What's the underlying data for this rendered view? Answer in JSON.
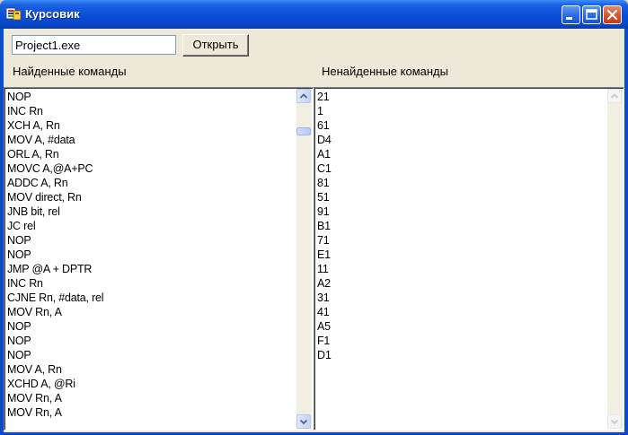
{
  "window": {
    "title": "Курсовик"
  },
  "toolbar": {
    "filename_value": "Project1.exe",
    "open_label": "Открыть"
  },
  "labels": {
    "found": "Найденные команды",
    "not_found": "Ненайденные команды"
  },
  "found_commands": [
    "NOP",
    "INC Rn",
    "XCH A, Rn",
    "MOV A, #data",
    "ORL A, Rn",
    "MOVC A,@A+PC",
    "ADDC A, Rn",
    "MOV direct, Rn",
    "JNB bit, rel",
    "JC rel",
    "NOP",
    "NOP",
    "JMP @A + DPTR",
    "INC Rn",
    "CJNE Rn, #data, rel",
    "MOV Rn, A",
    "NOP",
    "NOP",
    "NOP",
    "MOV A, Rn",
    "XCHD A, @Ri",
    "MOV Rn, A",
    "MOV Rn, A"
  ],
  "not_found_commands": [
    "21",
    "1",
    "61",
    "D4",
    "A1",
    "C1",
    "81",
    "51",
    "91",
    "B1",
    "71",
    "E1",
    "11",
    "A2",
    "31",
    "41",
    "A5",
    "F1",
    "D1"
  ],
  "icons": {
    "app": "app-icon",
    "minimize": "minimize-icon",
    "maximize": "maximize-icon",
    "close": "close-icon",
    "scroll_up": "chevron-up-icon",
    "scroll_down": "chevron-down-icon"
  }
}
